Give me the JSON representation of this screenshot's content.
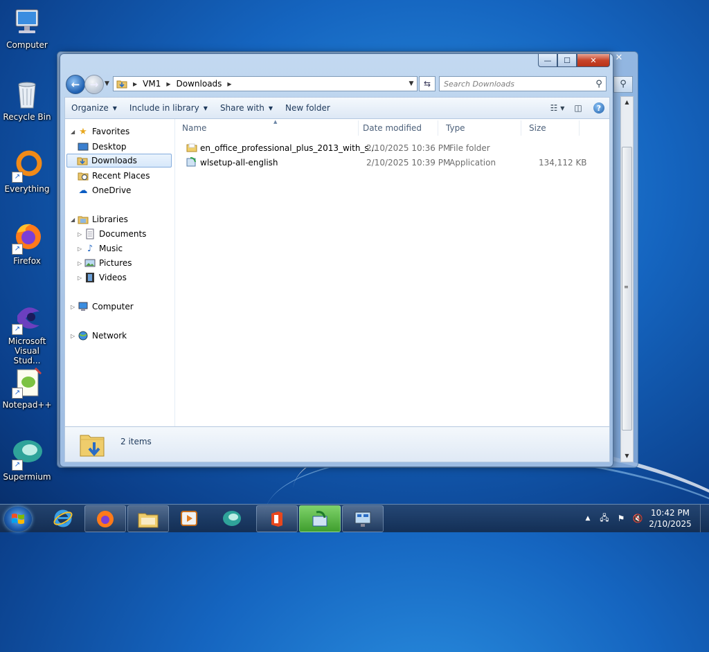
{
  "desktop": {
    "icons": [
      {
        "label": "Computer"
      },
      {
        "label": "Recycle Bin"
      },
      {
        "label": "Everything"
      },
      {
        "label": "Firefox"
      },
      {
        "label": "Microsoft Visual Stud..."
      },
      {
        "label": "Notepad++"
      },
      {
        "label": "Supermium"
      }
    ]
  },
  "window": {
    "close_glyph": "✕",
    "minimize_glyph": "—",
    "maximize_glyph": "☐",
    "address": {
      "crumbs": [
        "VM1",
        "Downloads"
      ]
    },
    "search": {
      "placeholder": "Search Downloads"
    },
    "toolbar": {
      "organize": "Organize",
      "include_in_library": "Include in library",
      "share_with": "Share with",
      "new_folder": "New folder"
    },
    "nav": {
      "favorites": "Favorites",
      "desktop": "Desktop",
      "downloads": "Downloads",
      "recent_places": "Recent Places",
      "onedrive": "OneDrive",
      "libraries": "Libraries",
      "documents": "Documents",
      "music": "Music",
      "pictures": "Pictures",
      "videos": "Videos",
      "computer": "Computer",
      "network": "Network"
    },
    "columns": {
      "name": "Name",
      "date_modified": "Date modified",
      "type": "Type",
      "size": "Size"
    },
    "files": [
      {
        "name": "en_office_professional_plus_2013_with_s...",
        "date": "2/10/2025 10:36 PM",
        "type": "File folder",
        "size": ""
      },
      {
        "name": "wlsetup-all-english",
        "date": "2/10/2025 10:39 PM",
        "type": "Application",
        "size": "134,112 KB"
      }
    ],
    "status": {
      "item_count": "2 items"
    }
  },
  "taskbar": {
    "clock_time": "10:42 PM",
    "clock_date": "2/10/2025"
  },
  "colors": {
    "accent": "#1e395b",
    "selection": "#d7e8fa",
    "close_button": "#c7452b"
  }
}
